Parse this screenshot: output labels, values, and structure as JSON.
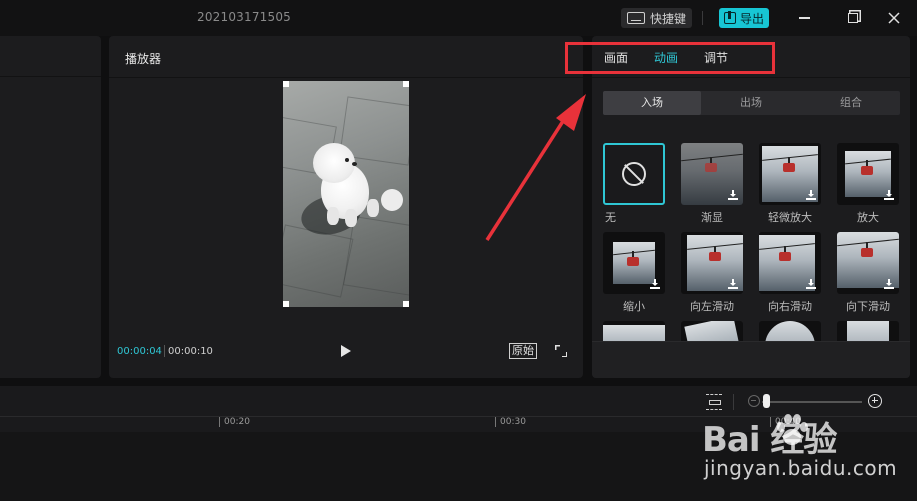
{
  "title_bar": {
    "project_name": "202103171505",
    "shortcut_label": "快捷键",
    "export_label": "导出",
    "export_color": "#17c6d4"
  },
  "player": {
    "header": "播放器",
    "current_time": "00:00:04",
    "total_time": "00:00:10",
    "ratio_label": "原始"
  },
  "inspector": {
    "tabs": [
      {
        "label": "画面",
        "active": false
      },
      {
        "label": "动画",
        "active": true
      },
      {
        "label": "调节",
        "active": false
      }
    ],
    "subtabs": [
      {
        "label": "入场",
        "active": true
      },
      {
        "label": "出场",
        "active": false
      },
      {
        "label": "组合",
        "active": false
      }
    ],
    "animations": [
      {
        "label": "无",
        "icon": "none-icon",
        "selected": true
      },
      {
        "label": "渐显",
        "icon": "download-icon"
      },
      {
        "label": "轻微放大",
        "icon": "download-icon"
      },
      {
        "label": "放大",
        "icon": "download-icon"
      },
      {
        "label": "缩小",
        "icon": "download-icon"
      },
      {
        "label": "向左滑动",
        "icon": "download-icon"
      },
      {
        "label": "向右滑动",
        "icon": "download-icon"
      },
      {
        "label": "向下滑动",
        "icon": "download-icon"
      }
    ],
    "accent_color": "#2fc6d4"
  },
  "timeline": {
    "ruler_marks": [
      "00:20",
      "00:30",
      "00:40"
    ]
  },
  "watermark": {
    "brand": "Bai  经验",
    "url": "jingyan.baidu.com"
  },
  "annotation": {
    "highlight_color": "#e8323a"
  }
}
